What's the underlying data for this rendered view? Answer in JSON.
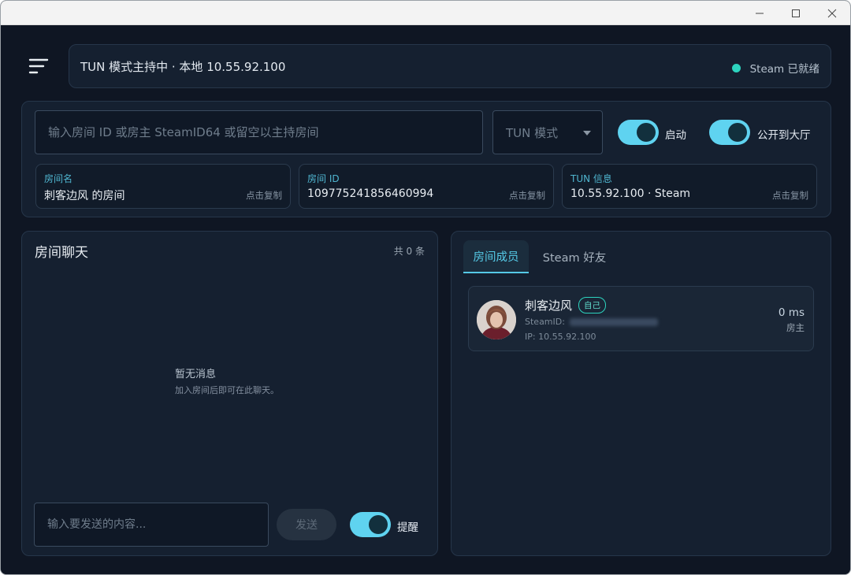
{
  "status": {
    "text": "TUN 模式主持中 · 本地 10.55.92.100",
    "steam": "Steam 已就绪",
    "steam_color": "#2dd4bf"
  },
  "controls": {
    "room_input_placeholder": "输入房间 ID 或房主 SteamID64 或留空以主持房间",
    "mode_value": "TUN 模式",
    "start_label": "启动",
    "public_label": "公开到大厅",
    "start_on": true,
    "public_on": true
  },
  "info_cards": [
    {
      "label": "房间名",
      "value": "刺客边风 的房间",
      "copy": "点击复制"
    },
    {
      "label": "房间 ID",
      "value": "109775241856460994",
      "copy": "点击复制"
    },
    {
      "label": "TUN 信息",
      "value": "10.55.92.100 · Steam",
      "copy": "点击复制"
    }
  ],
  "chat": {
    "title": "房间聊天",
    "count": "共 0 条",
    "empty_title": "暂无消息",
    "empty_sub": "加入房间后即可在此聊天。",
    "input_placeholder": "输入要发送的内容...",
    "send_label": "发送",
    "remind_label": "提醒"
  },
  "members": {
    "tabs": [
      {
        "label": "房间成员",
        "active": true
      },
      {
        "label": "Steam 好友",
        "active": false
      }
    ],
    "list": [
      {
        "name": "刺客边风",
        "badge": "自己",
        "steamid_label": "SteamID:",
        "ip": "IP: 10.55.92.100",
        "ping": "0 ms",
        "role": "房主"
      }
    ]
  },
  "accent": "#55c9e6"
}
